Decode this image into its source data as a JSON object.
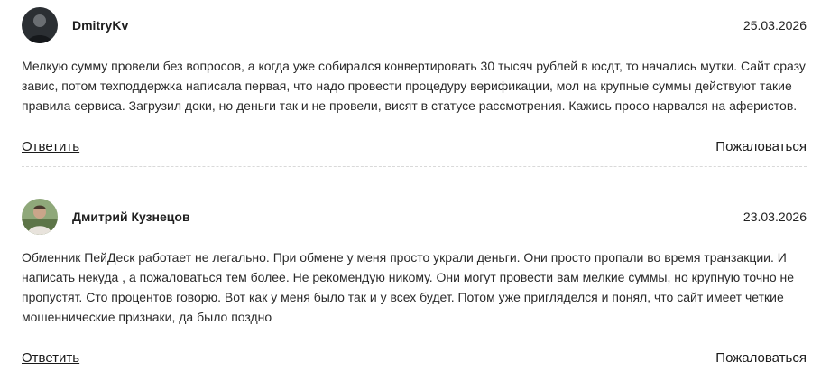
{
  "comments": [
    {
      "author": "DmitryKv",
      "date": "25.03.2026",
      "text": "Мелкую сумму провели без вопросов, а когда уже собирался конвертировать 30 тысяч рублей в юсдт, то начались мутки. Сайт сразу завис, потом техподдержка написала первая, что надо провести процедуру верификации, мол на крупные суммы действуют такие правила сервиса. Загрузил доки, но деньги так и не провели, висят в статусе рассмотрения. Кажись просо нарвался на аферистов.",
      "reply_label": "Ответить",
      "report_label": "Пожаловаться"
    },
    {
      "author": "Дмитрий Кузнецов",
      "date": "23.03.2026",
      "text": "Обменник ПейДеск работает не легально. При обмене у меня просто украли деньги. Они просто пропали во время транзакции. И написать некуда , а пожаловаться тем более. Не рекомендую никому. Они могут провести вам мелкие суммы, но крупную точно не пропустят. Сто процентов говорю. Вот как у меня было так и у всех будет. Потом уже пригляделся и понял, что сайт имеет четкие мошеннические признаки, да было поздно",
      "reply_label": "Ответить",
      "report_label": "Пожаловаться"
    }
  ]
}
